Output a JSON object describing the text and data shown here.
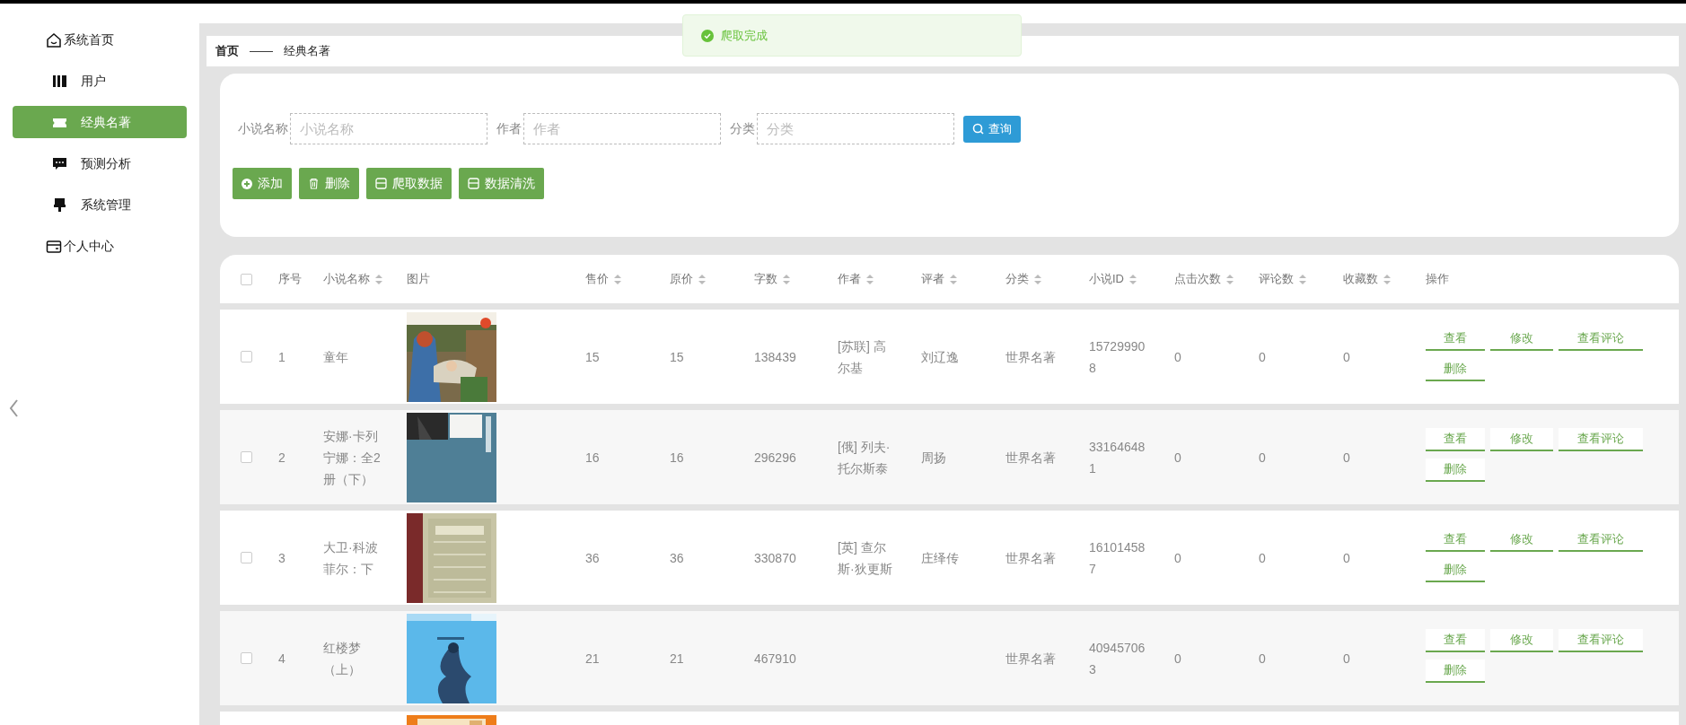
{
  "sidebar": {
    "items": [
      {
        "label": "系统首页",
        "kind": "page",
        "selected": false
      },
      {
        "label": "用户",
        "kind": "module",
        "selected": false
      },
      {
        "label": "经典名著",
        "kind": "module",
        "selected": true
      },
      {
        "label": "预测分析",
        "kind": "module",
        "selected": false
      },
      {
        "label": "系统管理",
        "kind": "module",
        "selected": false
      },
      {
        "label": "个人中心",
        "kind": "page",
        "selected": false
      }
    ]
  },
  "toast": {
    "text": "爬取完成"
  },
  "breadcrumb": [
    "首页",
    "——",
    "经典名著"
  ],
  "search": {
    "fields": [
      {
        "label": "小说名称",
        "placeholder": "小说名称"
      },
      {
        "label": "作者",
        "placeholder": "作者"
      },
      {
        "label": "分类",
        "placeholder": "分类"
      }
    ],
    "button": "查询"
  },
  "toolbar": [
    {
      "label": "添加",
      "kind": "add"
    },
    {
      "label": "删除",
      "kind": "delete"
    },
    {
      "label": "爬取数据",
      "kind": "data"
    },
    {
      "label": "数据清洗",
      "kind": "data"
    }
  ],
  "table": {
    "select_all": {
      "checked": false
    },
    "columns": [
      {
        "label": "序号",
        "sortable": false
      },
      {
        "label": "小说名称",
        "sortable": true
      },
      {
        "label": "图片",
        "sortable": false
      },
      {
        "label": "售价",
        "sortable": true
      },
      {
        "label": "原价",
        "sortable": true
      },
      {
        "label": "字数",
        "sortable": true
      },
      {
        "label": "作者",
        "sortable": true
      },
      {
        "label": "评者",
        "sortable": true
      },
      {
        "label": "分类",
        "sortable": true
      },
      {
        "label": "小说ID",
        "sortable": true
      },
      {
        "label": "点击次数",
        "sortable": true
      },
      {
        "label": "评论数",
        "sortable": true
      },
      {
        "label": "收藏数",
        "sortable": true
      },
      {
        "label": "操作",
        "sortable": false
      }
    ],
    "rows": [
      {
        "checked": false,
        "cells": [
          "1",
          "童年",
          null,
          "15",
          "15",
          "138439",
          "[苏联] 高尔基",
          "刘辽逸",
          "世界名著",
          "157299908",
          "0",
          "0",
          "0"
        ],
        "image": {
          "kind": "picture"
        },
        "actions": [
          "查看",
          "修改",
          "查看评论",
          "删除"
        ]
      },
      {
        "checked": false,
        "cells": [
          "2",
          "安娜·卡列宁娜：全2册（下）",
          null,
          "16",
          "16",
          "296296",
          "[俄] 列夫·托尔斯泰",
          "周扬",
          "世界名著",
          "331646481",
          "0",
          "0",
          "0"
        ],
        "image": {
          "kind": "picture"
        },
        "actions": [
          "查看",
          "修改",
          "查看评论",
          "删除"
        ]
      },
      {
        "checked": false,
        "cells": [
          "3",
          "大卫·科波菲尔：下",
          null,
          "36",
          "36",
          "330870",
          "[英] 查尔斯·狄更斯",
          "庄绎传",
          "世界名著",
          "161014587",
          "0",
          "0",
          "0"
        ],
        "image": {
          "kind": "picture"
        },
        "actions": [
          "查看",
          "修改",
          "查看评论",
          "删除"
        ]
      },
      {
        "checked": false,
        "cells": [
          "4",
          "红楼梦（上）",
          null,
          "21",
          "21",
          "467910",
          null,
          null,
          "世界名著",
          "409457063",
          "0",
          "0",
          "0"
        ],
        "image": {
          "kind": "picture"
        },
        "actions": [
          "查看",
          "修改",
          "查看评论",
          "删除"
        ]
      }
    ],
    "next_row_peek": {
      "kind": "picture"
    }
  }
}
